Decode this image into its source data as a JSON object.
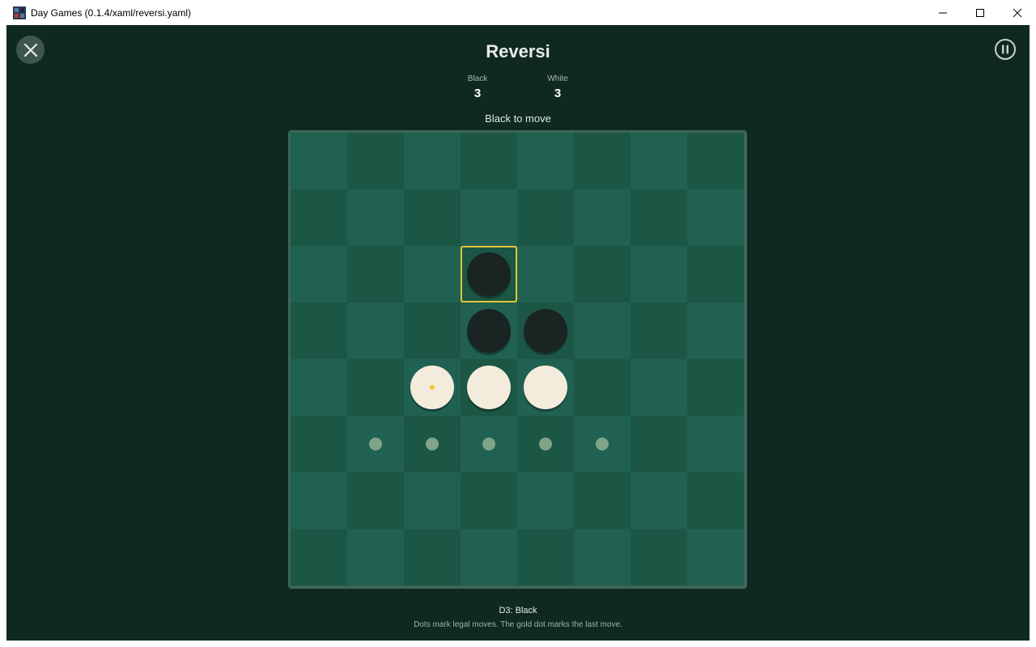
{
  "window": {
    "title": "Day Games (0.1.4/xaml/reversi.yaml)"
  },
  "game": {
    "title": "Reversi",
    "scores": [
      {
        "label": "Black",
        "value": "3"
      },
      {
        "label": "White",
        "value": "3"
      }
    ],
    "status": "Black to move",
    "last_move": "D3: Black",
    "hint": "Dots mark legal moves. The gold dot marks the last move."
  },
  "board": {
    "rows": [
      "........",
      "........",
      "...B....",
      "...BB...",
      "..WWW...",
      ".LLLLL..",
      "........",
      "........"
    ],
    "last_move_cell": {
      "row": 2,
      "col": 3
    },
    "gold_dot_cell": {
      "row": 4,
      "col": 2
    }
  },
  "colors": {
    "background": "#0f2922",
    "square_light": "#216151",
    "square_dark": "#1c5645",
    "black_disc": "#1a2523",
    "white_disc": "#f3ecdc",
    "highlight": "#e3c53b",
    "legal_dot": "#80a487"
  },
  "icons": {
    "close_game": "close-icon",
    "pause": "pause-icon"
  }
}
